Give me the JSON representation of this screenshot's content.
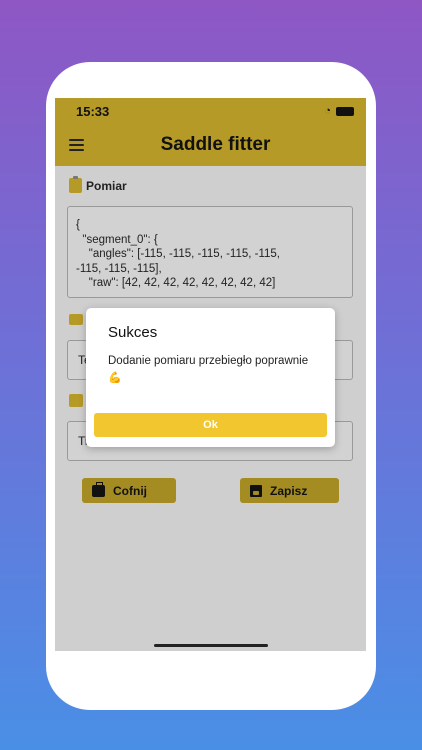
{
  "status_bar": {
    "time": "15:33"
  },
  "header": {
    "title": "Saddle fitter"
  },
  "measurement": {
    "label": "Pomiar",
    "code_lines": [
      "{",
      "  \"segment_0\": {",
      "    \"angles\": [-115, -115, -115, -115, -115,",
      "-115, -115, -115],",
      "    \"raw\": [42, 42, 42, 42, 42, 42, 42, 42]"
    ]
  },
  "field_1": {
    "value": "Te"
  },
  "field_2": {
    "value": "Ti"
  },
  "buttons": {
    "back_label": "Cofnij",
    "save_label": "Zapisz"
  },
  "dialog": {
    "title": "Sukces",
    "message": "Dodanie pomiaru przebiegło poprawnie",
    "emoji": "💪",
    "ok_label": "Ok"
  },
  "colors": {
    "accent": "#b59a27",
    "dialog_button": "#f2c62f",
    "background_top": "#8e57c4",
    "background_bottom": "#4a8fe6"
  }
}
